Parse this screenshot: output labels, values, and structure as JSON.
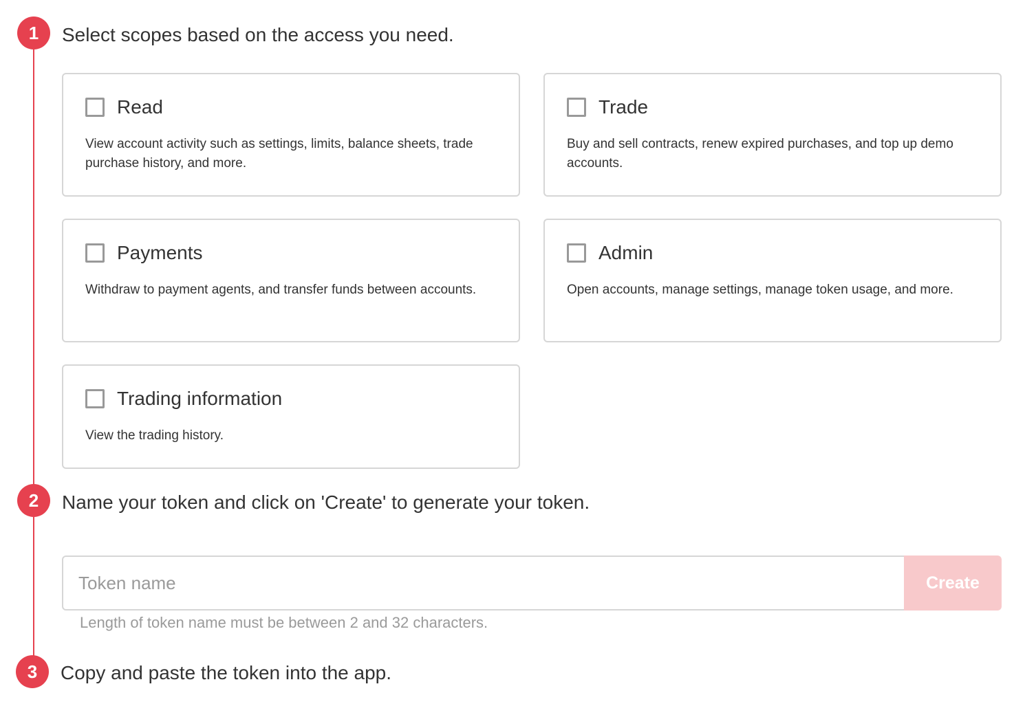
{
  "colors": {
    "accent": "#e6414f",
    "create_disabled_bg": "#f8c9cb",
    "card_border": "#d6d6d6",
    "checkbox_border": "#999999",
    "hint_text": "#9a9a9a"
  },
  "steps": [
    {
      "number": "1",
      "title": "Select scopes based on the access you need."
    },
    {
      "number": "2",
      "title": "Name your token and click on 'Create' to generate your token."
    },
    {
      "number": "3",
      "title": "Copy and paste the token into the app."
    }
  ],
  "scopes": [
    {
      "title": "Read",
      "description": "View account activity such as settings, limits, balance sheets, trade purchase history, and more.",
      "checked": false
    },
    {
      "title": "Trade",
      "description": "Buy and sell contracts, renew expired purchases, and top up demo accounts.",
      "checked": false
    },
    {
      "title": "Payments",
      "description": "Withdraw to payment agents, and transfer funds between accounts.",
      "checked": false
    },
    {
      "title": "Admin",
      "description": "Open accounts, manage settings, manage token usage, and more.",
      "checked": false
    },
    {
      "title": "Trading information",
      "description": "View the trading history.",
      "checked": false
    }
  ],
  "token_form": {
    "placeholder": "Token name",
    "value": "",
    "create_label": "Create",
    "create_enabled": false,
    "hint": "Length of token name must be between 2 and 32 characters."
  }
}
